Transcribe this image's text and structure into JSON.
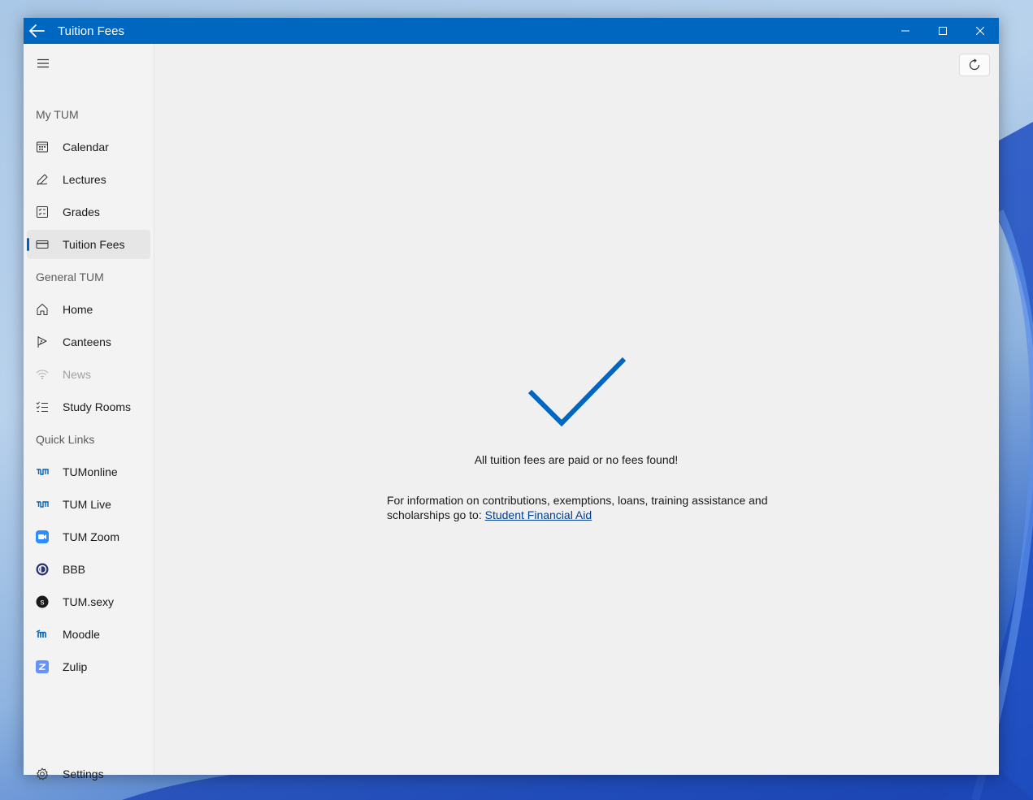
{
  "window": {
    "title": "Tuition Fees"
  },
  "sidebar": {
    "sections": [
      {
        "header": "My TUM",
        "items": [
          {
            "label": "Calendar",
            "icon": "calendar-icon"
          },
          {
            "label": "Lectures",
            "icon": "pen-icon"
          },
          {
            "label": "Grades",
            "icon": "grades-icon"
          },
          {
            "label": "Tuition Fees",
            "icon": "card-icon",
            "selected": true
          }
        ]
      },
      {
        "header": "General TUM",
        "items": [
          {
            "label": "Home",
            "icon": "home-icon"
          },
          {
            "label": "Canteens",
            "icon": "food-icon"
          },
          {
            "label": "News",
            "icon": "wifi-icon",
            "disabled": true
          },
          {
            "label": "Study Rooms",
            "icon": "checklist-icon"
          }
        ]
      },
      {
        "header": "Quick Links",
        "items": [
          {
            "label": "TUMonline",
            "icon": "tum-logo-icon"
          },
          {
            "label": "TUM Live",
            "icon": "tum-logo-icon"
          },
          {
            "label": "TUM Zoom",
            "icon": "zoom-icon"
          },
          {
            "label": "BBB",
            "icon": "bbb-icon"
          },
          {
            "label": "TUM.sexy",
            "icon": "tum-sexy-icon"
          },
          {
            "label": "Moodle",
            "icon": "moodle-icon"
          },
          {
            "label": "Zulip",
            "icon": "zulip-icon"
          }
        ]
      }
    ],
    "settings_label": "Settings"
  },
  "main": {
    "status_message": "All tuition fees are paid or no fees found!",
    "info_text": "For information on contributions, exemptions, loans, training assistance and scholarships go to: ",
    "info_link": "Student Financial Aid"
  },
  "colors": {
    "accent": "#0067c0",
    "check": "#0067c0",
    "link": "#003e92"
  }
}
